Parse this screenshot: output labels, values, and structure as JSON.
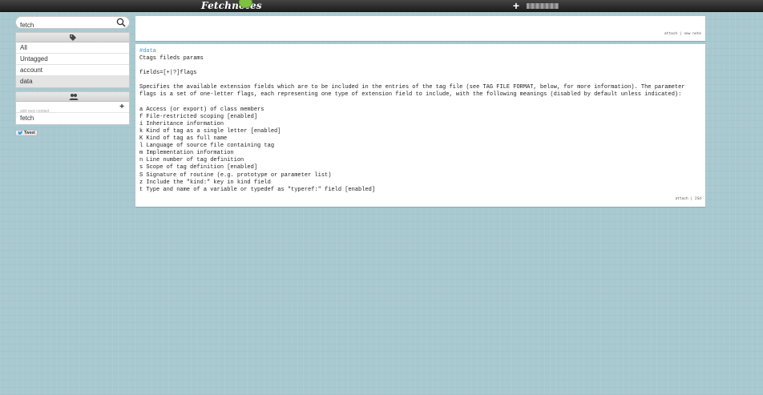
{
  "topbar": {
    "logo": "Fetchnotes",
    "add_icon": "plus-icon",
    "user_name_icon": "redacted-username"
  },
  "sidebar": {
    "search": {
      "value": "fetch",
      "placeholder": "",
      "icon": "search-icon"
    },
    "tags_icon": "tag-icon",
    "tags": [
      {
        "label": "All"
      },
      {
        "label": "Untagged"
      },
      {
        "label": "account"
      },
      {
        "label": "data",
        "selected": true
      }
    ],
    "contacts_icon": "users-icon",
    "add_contact_placeholder": "add new contact",
    "add_contact_button": "+",
    "contacts": [
      {
        "label": "fetch"
      }
    ],
    "tweet_label": "Tweet"
  },
  "composer": {
    "attach": "attach",
    "separator": "|",
    "new_note": "new note"
  },
  "note": {
    "tag": "#data",
    "title": "Ctags fileds params",
    "flag_syntax": "fields=[+|?]flags",
    "description": "Specifies the available extension fields which are to be included in the entries of the tag file (see TAG FILE FORMAT, below, for more information). The parameter flags is a set of one-letter flags, each representing one type of extension field to include, with the following meanings (disabled by default unless indicated):",
    "flags": [
      "a Access (or export) of class members",
      "f File-restricted scoping [enabled]",
      "i Inheritance information",
      "k Kind of tag as a single letter [enabled]",
      "K Kind of tag as full name",
      "l Language of source file containing tag",
      "m Implementation information",
      "n Line number of tag definition",
      "s Scope of tag definition [enabled]",
      "S Signature of routine (e.g. prototype or parameter list)",
      "z Include the \"kind:\" key in kind field",
      "t Type and name of a variable or typedef as \"typeref:\" field [enabled]"
    ],
    "footer_attach": "attach",
    "footer_separator": "|",
    "footer_id": "2Sd"
  }
}
